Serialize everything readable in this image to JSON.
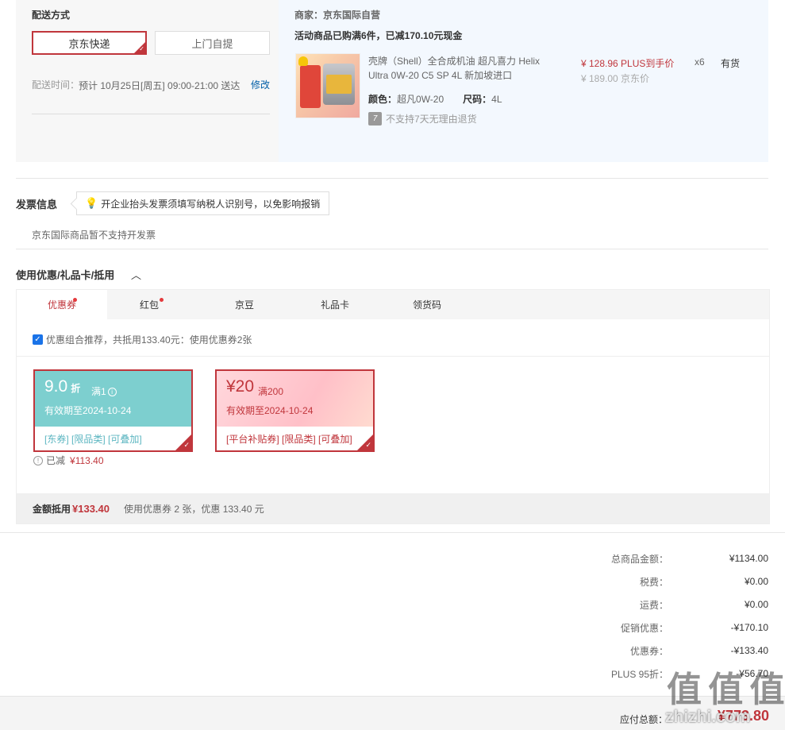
{
  "delivery": {
    "title": "配送方式",
    "options": [
      "京东快递",
      "上门自提"
    ],
    "time_label": "配送时间：",
    "time_value": "预计 10月25日[周五] 09:00-21:00 送达",
    "modify": "修改"
  },
  "order": {
    "merchant_label": "商家：",
    "merchant": "京东国际自营",
    "promo": "活动商品已购满6件，已减170.10元现金",
    "product": {
      "name": "壳牌（Shell）全合成机油 超凡喜力 Helix Ultra 0W-20 C5 SP 4L 新加坡进口",
      "color_label": "颜色：",
      "color": "超凡0W-20",
      "size_label": "尺码：",
      "size": "4L",
      "no_return_badge": "7",
      "no_return": "不支持7天无理由退货",
      "price_plus": "¥ 128.96 PLUS到手价",
      "price_jd": "¥ 189.00 京东价",
      "qty": "x6",
      "stock": "有货"
    }
  },
  "invoice": {
    "title": "发票信息",
    "tip": "开企业抬头发票须填写纳税人识别号，以免影响报销",
    "note": "京东国际商品暂不支持开发票"
  },
  "coupons": {
    "title": "使用优惠/礼品卡/抵用",
    "toggle": "︿",
    "tabs": [
      "优惠券",
      "红包",
      "京豆",
      "礼品卡",
      "领货码"
    ],
    "combo": "优惠组合推荐，共抵用133.40元：使用优惠券2张",
    "items": [
      {
        "amount": "9.0",
        "unit": "折",
        "cond": "满1",
        "valid": "有效期至2024-10-24",
        "tags": "[东券]  [限品类]  [可叠加]"
      },
      {
        "amount": "¥20",
        "unit": "",
        "cond": "满200",
        "valid": "有效期至2024-10-24",
        "tags": "[平台补贴券]  [限品类]  [可叠加]"
      }
    ],
    "reduced_label": "已减",
    "reduced_value": "¥113.40",
    "deduct_label": "金额抵用",
    "deduct_value": "¥133.40",
    "deduct_desc": "使用优惠券 2 张，优惠 133.40 元"
  },
  "summary": {
    "rows": [
      {
        "k": "总商品金额：",
        "v": "¥1134.00"
      },
      {
        "k": "税费：",
        "v": "¥0.00"
      },
      {
        "k": "运费：",
        "v": "¥0.00"
      },
      {
        "k": "促销优惠：",
        "v": "-¥170.10"
      },
      {
        "k": "优惠券：",
        "v": "-¥133.40"
      },
      {
        "k": "PLUS 95折：",
        "v": "-¥56.70"
      }
    ],
    "total_label": "应付总额：",
    "total_value": "¥773.80"
  },
  "watermark": {
    "main": "值 值 值",
    "sub": "zhizhi.com"
  }
}
